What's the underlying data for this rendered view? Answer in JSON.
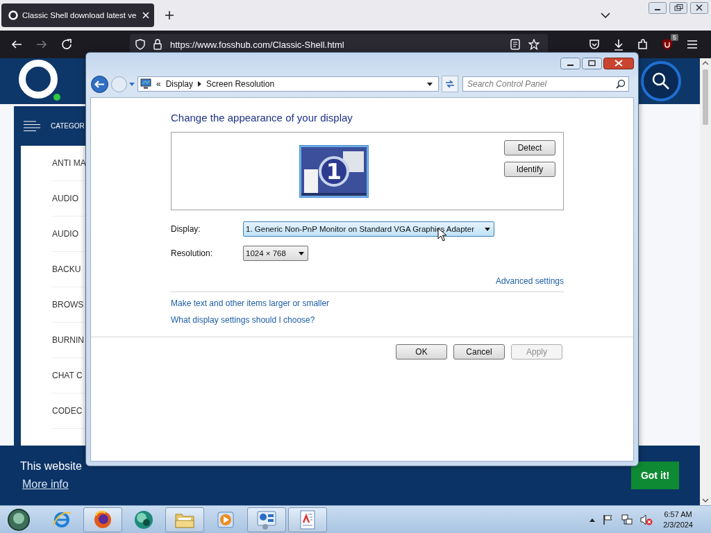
{
  "browser": {
    "tab": {
      "title": "Classic Shell download latest ve"
    },
    "url": "https://www.fosshub.com/Classic-Shell.html",
    "extension_badge": "5"
  },
  "webpage": {
    "categories_header": "CATEGOR",
    "categories": [
      "ANTI MA",
      "AUDIO",
      "AUDIO",
      "BACKU",
      "BROWS",
      "BURNIN",
      "CHAT C",
      "CODEC"
    ],
    "cookie_banner": {
      "text": "This website",
      "link": "More info",
      "button": "Got it!"
    }
  },
  "dialog": {
    "breadcrumb_chevron": "«",
    "breadcrumb": [
      "Display",
      "Screen Resolution"
    ],
    "search_placeholder": "Search Control Panel",
    "heading": "Change the appearance of your display",
    "monitor_label": "1",
    "side_buttons": [
      "Detect",
      "Identify"
    ],
    "fields": [
      {
        "label": "Display:",
        "value": "1. Generic Non-PnP Monitor on Standard VGA Graphics Adapter",
        "focused": true,
        "kind": "wide"
      },
      {
        "label": "Resolution:",
        "value": "1024 × 768",
        "focused": false,
        "kind": "narrow"
      }
    ],
    "advanced_link": "Advanced settings",
    "links": [
      "Make text and other items larger or smaller",
      "What display settings should I choose?"
    ],
    "footer_buttons": [
      {
        "label": "OK",
        "disabled": false
      },
      {
        "label": "Cancel",
        "disabled": false
      },
      {
        "label": "Apply",
        "disabled": true
      }
    ]
  },
  "taskbar": {
    "apps": [
      {
        "kind": "ie",
        "running": false
      },
      {
        "kind": "firefox",
        "running": true
      },
      {
        "kind": "orb",
        "running": false
      },
      {
        "kind": "folder",
        "running": true
      },
      {
        "kind": "media",
        "running": false
      },
      {
        "kind": "control",
        "running": true
      },
      {
        "kind": "wordpad",
        "running": true
      }
    ],
    "time": "6:57 AM",
    "date": "2/3/2024"
  }
}
